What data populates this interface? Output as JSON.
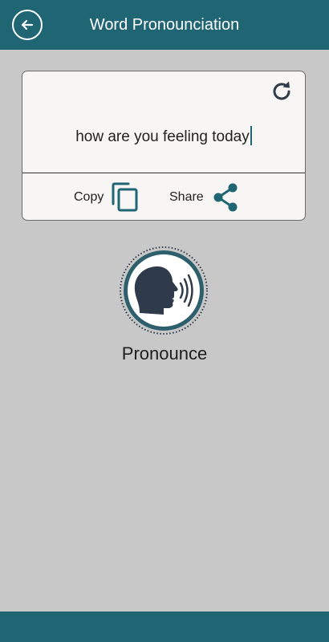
{
  "app_bar": {
    "title": "Word Pronounciation",
    "back_icon": "arrow-left-icon"
  },
  "card": {
    "text_value": "how are you feeling today",
    "refresh_icon": "refresh-icon",
    "copy_label": "Copy",
    "copy_icon": "copy-icon",
    "share_label": "Share",
    "share_icon": "share-icon"
  },
  "pronounce": {
    "label": "Pronounce",
    "icon": "speaking-head-icon"
  },
  "colors": {
    "primary": "#1f6574",
    "background": "#c8c8c8",
    "card_background": "#f7f6f4",
    "icon_dark": "#2f3a4a"
  }
}
